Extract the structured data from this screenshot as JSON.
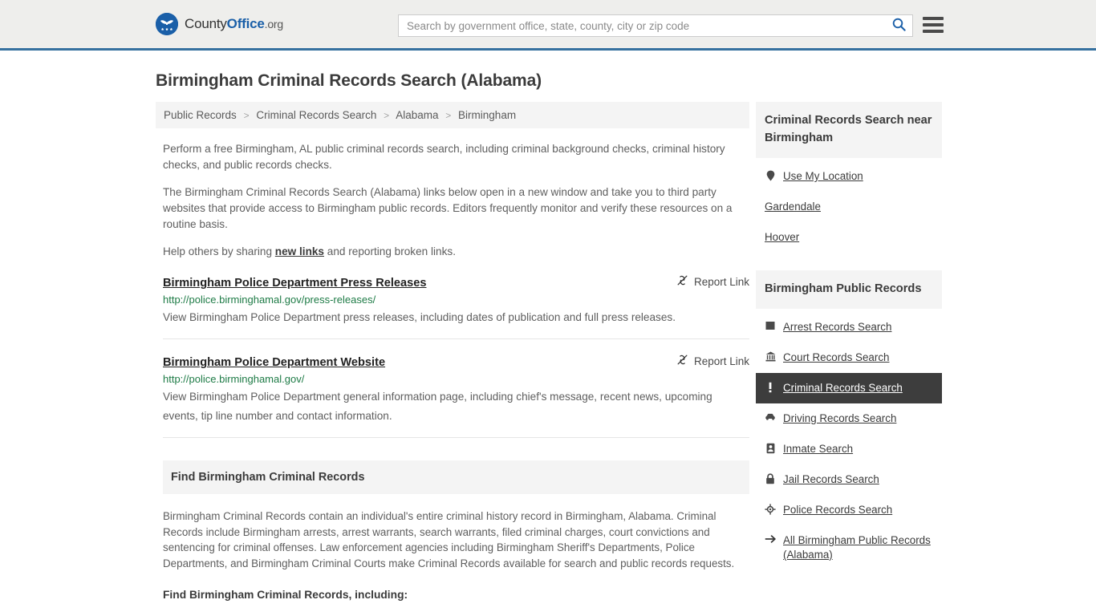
{
  "header": {
    "logo_text_1": "County",
    "logo_text_2": "Office",
    "logo_text_3": ".org",
    "logo_icon": "eagle-stars-icon",
    "search_placeholder": "Search by government office, state, county, city or zip code",
    "search_value": "",
    "search_icon": "search-icon",
    "menu_icon": "hamburger-menu-icon",
    "accent_color": "#36719f",
    "background_color": "#eeeeec"
  },
  "page": {
    "title": "Birmingham Criminal Records Search (Alabama)"
  },
  "breadcrumb": {
    "separator": ">",
    "items": [
      {
        "label": "Public Records"
      },
      {
        "label": "Criminal Records Search"
      },
      {
        "label": "Alabama"
      },
      {
        "label": "Birmingham"
      }
    ]
  },
  "intro": {
    "p1": "Perform a free Birmingham, AL public criminal records search, including criminal background checks, criminal history checks, and public records checks.",
    "p2": "The Birmingham Criminal Records Search (Alabama) links below open in a new window and take you to third party websites that provide access to Birmingham public records. Editors frequently monitor and verify these resources on a routine basis.",
    "p3_before": "Help others by sharing ",
    "p3_link": "new links",
    "p3_after": " and reporting broken links."
  },
  "results": {
    "report_label": "Report Link",
    "report_icon": "broken-link-icon",
    "items": [
      {
        "title": "Birmingham Police Department Press Releases",
        "url": "http://police.birminghamal.gov/press-releases/",
        "description": "View Birmingham Police Department press releases, including dates of publication and full press releases."
      },
      {
        "title": "Birmingham Police Department Website",
        "url": "http://police.birminghamal.gov/",
        "description": "View Birmingham Police Department general information page, including chief's message, recent news, upcoming events, tip line number and contact information."
      }
    ]
  },
  "find_section": {
    "heading": "Find Birmingham Criminal Records",
    "paragraph": "Birmingham Criminal Records contain an individual's entire criminal history record in Birmingham, Alabama. Criminal Records include Birmingham arrests, arrest warrants, search warrants, filed criminal charges, court convictions and sentencing for criminal offenses. Law enforcement agencies including Birmingham Sheriff's Departments, Police Departments, and Birmingham Criminal Courts make Criminal Records available for search and public records requests.",
    "subheading": "Find Birmingham Criminal Records, including:"
  },
  "sidebar": {
    "nearby": {
      "heading": "Criminal Records Search near Birmingham",
      "items": [
        {
          "label": "Use My Location",
          "icon": "map-pin-icon",
          "active": false
        },
        {
          "label": "Gardendale",
          "icon": "",
          "active": false
        },
        {
          "label": "Hoover",
          "icon": "",
          "active": false
        }
      ]
    },
    "public_records": {
      "heading": "Birmingham Public Records",
      "active_color": "#3d3d3d",
      "items": [
        {
          "label": "Arrest Records Search",
          "icon": "square-icon",
          "active": false
        },
        {
          "label": "Court Records Search",
          "icon": "courthouse-icon",
          "active": false
        },
        {
          "label": "Criminal Records Search",
          "icon": "exclamation-icon",
          "active": true
        },
        {
          "label": "Driving Records Search",
          "icon": "car-icon",
          "active": false
        },
        {
          "label": "Inmate Search",
          "icon": "id-badge-icon",
          "active": false
        },
        {
          "label": "Jail Records Search",
          "icon": "padlock-icon",
          "active": false
        },
        {
          "label": "Police Records Search",
          "icon": "police-badge-icon",
          "active": false
        },
        {
          "label": "All Birmingham Public Records (Alabama)",
          "icon": "arrow-right-icon",
          "active": false
        }
      ]
    }
  }
}
